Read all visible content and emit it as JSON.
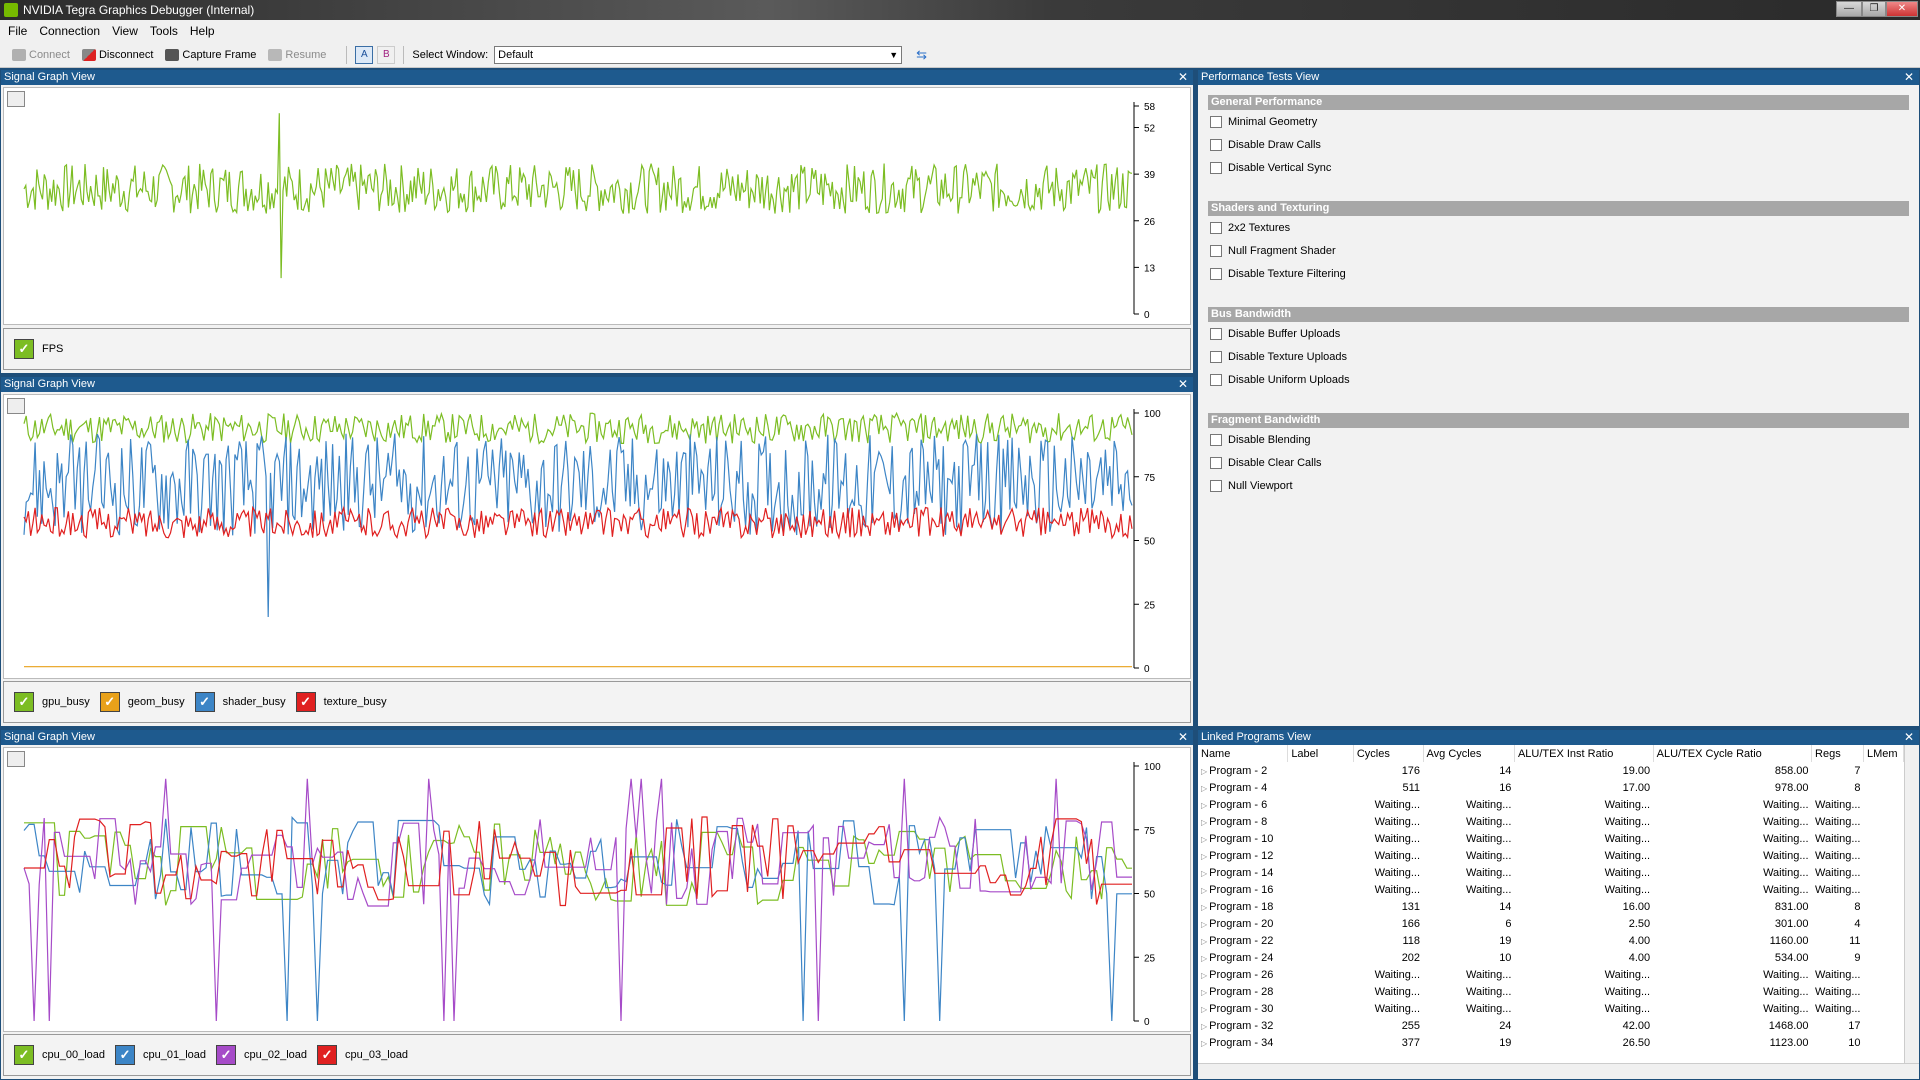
{
  "window": {
    "title": "NVIDIA Tegra Graphics Debugger (Internal)",
    "controls": [
      "—",
      "❐",
      "✕"
    ]
  },
  "menu": [
    "File",
    "Connection",
    "View",
    "Tools",
    "Help"
  ],
  "toolbar": {
    "connect": "Connect",
    "disconnect": "Disconnect",
    "capture": "Capture Frame",
    "resume": "Resume",
    "mode_a": "A",
    "mode_b": "B",
    "select_window_label": "Select Window:",
    "select_window_value": "Default"
  },
  "graphs": [
    {
      "header": "Signal Graph View",
      "yticks": [
        "58",
        "52",
        "39",
        "26",
        "13",
        "0"
      ],
      "ymax": 58,
      "series": [
        {
          "name": "FPS",
          "color": "#7cbd23"
        }
      ]
    },
    {
      "header": "Signal Graph View",
      "yticks": [
        "100",
        "75",
        "50",
        "25",
        "0"
      ],
      "ymax": 100,
      "series": [
        {
          "name": "gpu_busy",
          "color": "#7cbd23"
        },
        {
          "name": "geom_busy",
          "color": "#e8a11a"
        },
        {
          "name": "shader_busy",
          "color": "#3d85c6"
        },
        {
          "name": "texture_busy",
          "color": "#e02020"
        }
      ]
    },
    {
      "header": "Signal Graph View",
      "yticks": [
        "100",
        "75",
        "50",
        "25",
        "0"
      ],
      "ymax": 100,
      "series": [
        {
          "name": "cpu_00_load",
          "color": "#7cbd23"
        },
        {
          "name": "cpu_01_load",
          "color": "#3d85c6"
        },
        {
          "name": "cpu_02_load",
          "color": "#a64bc8"
        },
        {
          "name": "cpu_03_load",
          "color": "#e02020"
        }
      ]
    }
  ],
  "perf": {
    "header": "Performance Tests View",
    "sections": [
      {
        "title": "General Performance",
        "options": [
          "Minimal Geometry",
          "Disable Draw Calls",
          "Disable Vertical Sync"
        ]
      },
      {
        "title": "Shaders and Texturing",
        "options": [
          "2x2 Textures",
          "Null Fragment Shader",
          "Disable Texture Filtering"
        ]
      },
      {
        "title": "Bus Bandwidth",
        "options": [
          "Disable Buffer Uploads",
          "Disable Texture Uploads",
          "Disable Uniform Uploads"
        ]
      },
      {
        "title": "Fragment Bandwidth",
        "options": [
          "Disable Blending",
          "Disable Clear Calls",
          "Null Viewport"
        ]
      }
    ]
  },
  "linked": {
    "header": "Linked Programs View",
    "columns": [
      "Name",
      "Label",
      "Cycles",
      "Avg Cycles",
      "ALU/TEX Inst Ratio",
      "ALU/TEX Cycle Ratio",
      "Regs",
      "LMem"
    ],
    "rows": [
      [
        "Program - 2",
        "",
        "176",
        "14",
        "19.00",
        "858.00",
        "7",
        ""
      ],
      [
        "Program - 4",
        "",
        "511",
        "16",
        "17.00",
        "978.00",
        "8",
        ""
      ],
      [
        "Program - 6",
        "",
        "Waiting...",
        "Waiting...",
        "Waiting...",
        "Waiting...",
        "Waiting...",
        ""
      ],
      [
        "Program - 8",
        "",
        "Waiting...",
        "Waiting...",
        "Waiting...",
        "Waiting...",
        "Waiting...",
        ""
      ],
      [
        "Program - 10",
        "",
        "Waiting...",
        "Waiting...",
        "Waiting...",
        "Waiting...",
        "Waiting...",
        ""
      ],
      [
        "Program - 12",
        "",
        "Waiting...",
        "Waiting...",
        "Waiting...",
        "Waiting...",
        "Waiting...",
        ""
      ],
      [
        "Program - 14",
        "",
        "Waiting...",
        "Waiting...",
        "Waiting...",
        "Waiting...",
        "Waiting...",
        ""
      ],
      [
        "Program - 16",
        "",
        "Waiting...",
        "Waiting...",
        "Waiting...",
        "Waiting...",
        "Waiting...",
        ""
      ],
      [
        "Program - 18",
        "",
        "131",
        "14",
        "16.00",
        "831.00",
        "8",
        ""
      ],
      [
        "Program - 20",
        "",
        "166",
        "6",
        "2.50",
        "301.00",
        "4",
        ""
      ],
      [
        "Program - 22",
        "",
        "118",
        "19",
        "4.00",
        "1160.00",
        "11",
        ""
      ],
      [
        "Program - 24",
        "",
        "202",
        "10",
        "4.00",
        "534.00",
        "9",
        ""
      ],
      [
        "Program - 26",
        "",
        "Waiting...",
        "Waiting...",
        "Waiting...",
        "Waiting...",
        "Waiting...",
        ""
      ],
      [
        "Program - 28",
        "",
        "Waiting...",
        "Waiting...",
        "Waiting...",
        "Waiting...",
        "Waiting...",
        ""
      ],
      [
        "Program - 30",
        "",
        "Waiting...",
        "Waiting...",
        "Waiting...",
        "Waiting...",
        "Waiting...",
        ""
      ],
      [
        "Program - 32",
        "",
        "255",
        "24",
        "42.00",
        "1468.00",
        "17",
        ""
      ],
      [
        "Program - 34",
        "",
        "377",
        "19",
        "26.50",
        "1123.00",
        "10",
        ""
      ]
    ]
  }
}
